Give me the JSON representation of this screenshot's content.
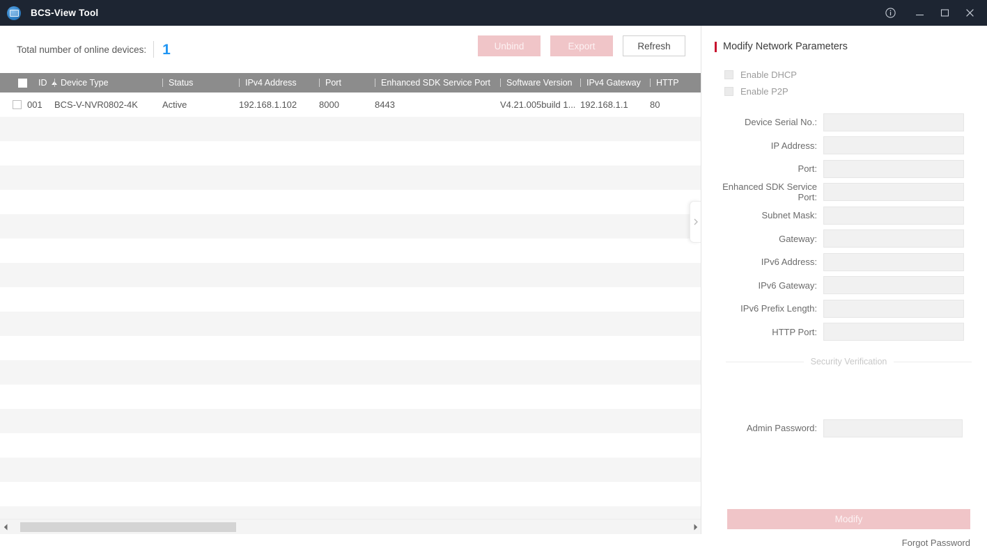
{
  "titlebar": {
    "app_title": "BCS-View Tool",
    "logo_icon": "camera-circle-logo",
    "info_icon": "info-circle-icon",
    "minimize_icon": "minimize-icon",
    "maximize_icon": "maximize-icon",
    "close_icon": "close-icon",
    "background_color": "#1d2532"
  },
  "toolbar": {
    "total_label": "Total number of online devices:",
    "total_count": "1",
    "count_color": "#2196f3",
    "unbind_label": "Unbind",
    "export_label": "Export",
    "refresh_label": "Refresh",
    "disabled_button_color": "#f0c5c8"
  },
  "table": {
    "select_all_checkbox": "unchecked",
    "sort_column": "ID",
    "sort_direction": "ascending",
    "columns": [
      {
        "key": "id",
        "label": "ID"
      },
      {
        "key": "device_type",
        "label": "Device Type"
      },
      {
        "key": "status",
        "label": "Status"
      },
      {
        "key": "ipv4",
        "label": "IPv4 Address"
      },
      {
        "key": "port",
        "label": "Port"
      },
      {
        "key": "sdk_port",
        "label": "Enhanced SDK Service Port"
      },
      {
        "key": "software_version",
        "label": "Software Version"
      },
      {
        "key": "ipv4_gateway",
        "label": "IPv4 Gateway"
      },
      {
        "key": "http_port",
        "label": "HTTP"
      }
    ],
    "rows": [
      {
        "checked": false,
        "id": "001",
        "device_type": "BCS-V-NVR0802-4K",
        "status": "Active",
        "ipv4": "192.168.1.102",
        "port": "8000",
        "sdk_port": "8443",
        "software_version": "V4.21.005build 1...",
        "ipv4_gateway": "192.168.1.1",
        "http_port": "80"
      }
    ],
    "header_background": "#8c8c8c",
    "stripe_color": "#f5f5f5"
  },
  "collapse_handle": {
    "icon": "chevron-right-icon"
  },
  "scrollbar": {
    "left_arrow_icon": "scroll-left-arrow-icon",
    "right_arrow_icon": "scroll-right-arrow-icon"
  },
  "panel": {
    "title": "Modify Network Parameters",
    "accent_color": "#c8102e",
    "checkboxes": [
      {
        "label": "Enable DHCP",
        "checked": false,
        "disabled": true
      },
      {
        "label": "Enable P2P",
        "checked": false,
        "disabled": true
      }
    ],
    "fields": [
      {
        "label": "Device Serial No.:",
        "value": "",
        "placeholder": ""
      },
      {
        "label": "IP Address:",
        "value": "",
        "placeholder": ""
      },
      {
        "label": "Port:",
        "value": "",
        "placeholder": ""
      },
      {
        "label": "Enhanced SDK Service Port:",
        "value": "",
        "placeholder": ""
      },
      {
        "label": "Subnet Mask:",
        "value": "",
        "placeholder": ""
      },
      {
        "label": "Gateway:",
        "value": "",
        "placeholder": ""
      },
      {
        "label": "IPv6 Address:",
        "value": "",
        "placeholder": ""
      },
      {
        "label": "IPv6 Gateway:",
        "value": "",
        "placeholder": ""
      },
      {
        "label": "IPv6 Prefix Length:",
        "value": "",
        "placeholder": ""
      },
      {
        "label": "HTTP Port:",
        "value": "",
        "placeholder": ""
      }
    ],
    "divider_text": "Security Verification",
    "admin_password_label": "Admin Password:",
    "admin_password_value": "",
    "modify_label": "Modify",
    "forgot_password_label": "Forgot Password"
  }
}
